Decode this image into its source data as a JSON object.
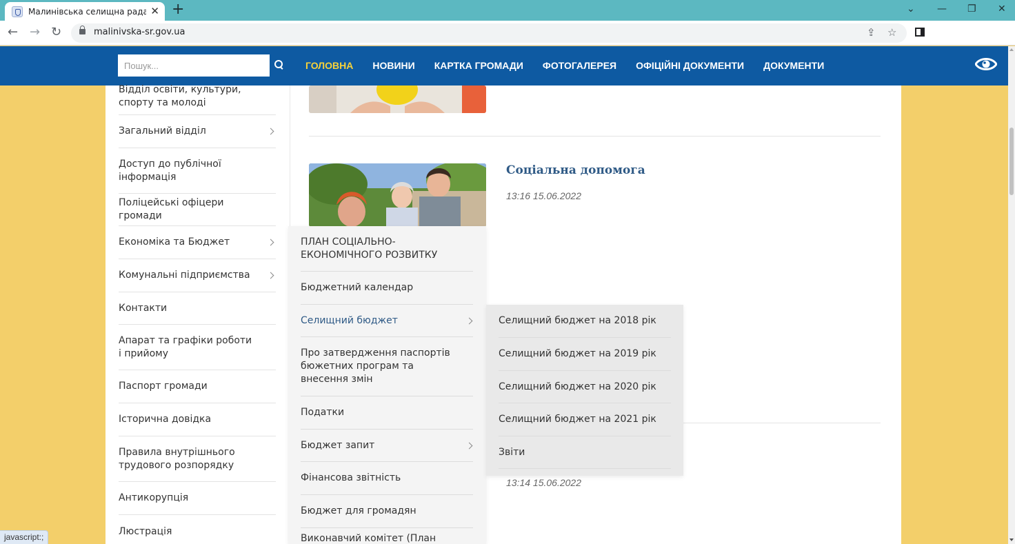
{
  "browser": {
    "tab_title": "Малинівська селищна рада Чугуївського району",
    "url": "malinivska-sr.gov.ua",
    "new_tab": "+",
    "close_tab": "✕"
  },
  "site": {
    "search_placeholder": "Пошук...",
    "menu": [
      {
        "label": "ГОЛОВНА",
        "active": true
      },
      {
        "label": "НОВИНИ"
      },
      {
        "label": "КАРТКА ГРОМАДИ"
      },
      {
        "label": "ФОТОГАЛЕРЕЯ"
      },
      {
        "label": "ОФІЦІЙНІ ДОКУМЕНТИ"
      },
      {
        "label": "ДОКУМЕНТИ"
      }
    ],
    "colors": {
      "nav": "#0e5aa2",
      "active_menu": "#f7d23a",
      "link": "#2f5a86"
    }
  },
  "sidebar": {
    "items": [
      {
        "label": "Відділ освіти, культури, спорту та молоді"
      },
      {
        "label": "Загальний відділ",
        "has_children": true
      },
      {
        "label": "Доступ до публічної інформація"
      },
      {
        "label": "Поліцейські офіцери громади"
      },
      {
        "label": "Економіка та Бюджет",
        "has_children": true
      },
      {
        "label": "Комунальні підприємства",
        "has_children": true
      },
      {
        "label": "Контакти"
      },
      {
        "label": "Апарат та графіки роботи і прийому"
      },
      {
        "label": "Паспорт громади"
      },
      {
        "label": "Історична довідка"
      },
      {
        "label": "Правила внутрішнього трудового розпорядку"
      },
      {
        "label": "Антикорупція"
      },
      {
        "label": "Люстрація"
      }
    ]
  },
  "articles": [
    {
      "title": "Соціальна допомога",
      "date": "13:16 15.06.2022"
    },
    {
      "date": "13:14 15.06.2022"
    }
  ],
  "dropdown_economy": {
    "items": [
      {
        "label": "ПЛАН СОЦІАЛЬНО-ЕКОНОМІЧНОГО РОЗВИТКУ"
      },
      {
        "label": "Бюджетний календар"
      },
      {
        "label": "Селищний бюджет",
        "has_children": true,
        "hovered": true
      },
      {
        "label": "Про затвердження паспортів бюжетних програм та внесення змін"
      },
      {
        "label": "Податки"
      },
      {
        "label": "Бюджет запит",
        "has_children": true
      },
      {
        "label": "Фінансова звітність"
      },
      {
        "label": "Бюджет для громадян"
      },
      {
        "label": "Виконавчий комітет (План"
      }
    ]
  },
  "dropdown_budget": {
    "items": [
      {
        "label": "Селищний бюджет на 2018 рік"
      },
      {
        "label": "Селищний бюджет на 2019 рік"
      },
      {
        "label": "Селищний бюджет на 2020 рік"
      },
      {
        "label": "Селищний бюджет на 2021 рік"
      },
      {
        "label": "Звіти"
      }
    ]
  },
  "status_bar": "javascript:;"
}
